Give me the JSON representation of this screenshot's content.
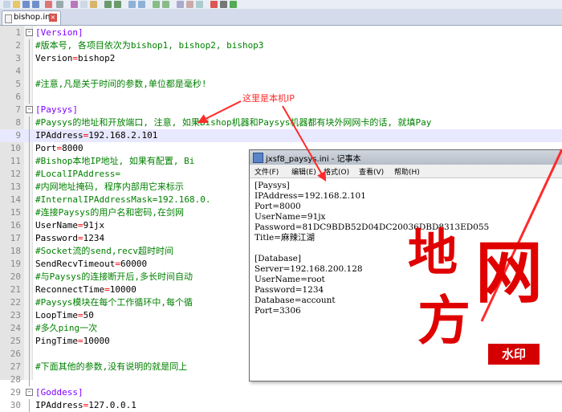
{
  "tab": {
    "label": "bishop.ini"
  },
  "editor": {
    "lines": [
      {
        "n": "1",
        "type": "section",
        "text": "[Version]"
      },
      {
        "n": "2",
        "type": "comment",
        "text": "#版本号, 各项目依次为bishop1, bishop2, bishop3"
      },
      {
        "n": "3",
        "type": "kv",
        "key": "Version",
        "value": "bishop2"
      },
      {
        "n": "4",
        "type": "blank",
        "text": ""
      },
      {
        "n": "5",
        "type": "comment",
        "text": "#注意,凡是关于时间的参数,单位都是毫秒!"
      },
      {
        "n": "6",
        "type": "blank",
        "text": ""
      },
      {
        "n": "7",
        "type": "section",
        "text": "[Paysys]"
      },
      {
        "n": "8",
        "type": "comment",
        "text": "#Paysys的地址和开放端口, 注意, 如果Bishop机器和Paysys机器都有块外网网卡的话, 就填Pay"
      },
      {
        "n": "9",
        "type": "kv",
        "key": "IPAddress",
        "value": "192.168.2.101",
        "highlight": true
      },
      {
        "n": "10",
        "type": "kv",
        "key": "Port",
        "value": "8000"
      },
      {
        "n": "11",
        "type": "comment",
        "text": "#Bishop本地IP地址, 如果有配置, Bi"
      },
      {
        "n": "12",
        "type": "comment",
        "text": "#LocalIPAddress="
      },
      {
        "n": "13",
        "type": "comment",
        "text": "#内网地址掩码, 程序内部用它来标示"
      },
      {
        "n": "14",
        "type": "comment",
        "text": "#InternalIPAddressMask=192.168.0."
      },
      {
        "n": "15",
        "type": "comment",
        "text": "#连接Paysys的用户名和密码,在剑网"
      },
      {
        "n": "16",
        "type": "kv",
        "key": "UserName",
        "value": "91jx"
      },
      {
        "n": "17",
        "type": "kv",
        "key": "Password",
        "value": "1234"
      },
      {
        "n": "18",
        "type": "comment",
        "text": "#Socket流的send,recv超时时间"
      },
      {
        "n": "19",
        "type": "kv",
        "key": "SendRecvTimeout",
        "value": "60000"
      },
      {
        "n": "20",
        "type": "comment",
        "text": "#与Paysys的连接断开后,多长时间自动"
      },
      {
        "n": "21",
        "type": "kv",
        "key": "ReconnectTime",
        "value": "10000"
      },
      {
        "n": "22",
        "type": "comment",
        "text": "#Paysys模块在每个工作循环中,每个循"
      },
      {
        "n": "23",
        "type": "kv",
        "key": "LoopTime",
        "value": "50"
      },
      {
        "n": "24",
        "type": "comment",
        "text": "#多久ping一次"
      },
      {
        "n": "25",
        "type": "kv",
        "key": "PingTime",
        "value": "10000"
      },
      {
        "n": "26",
        "type": "blank",
        "text": ""
      },
      {
        "n": "27",
        "type": "comment",
        "text": "#下面其他的参数,没有说明的就是同上"
      },
      {
        "n": "28",
        "type": "blank",
        "text": ""
      },
      {
        "n": "29",
        "type": "section",
        "text": "[Goddess]"
      },
      {
        "n": "30",
        "type": "kv",
        "key": "IPAddress",
        "value": "127.0.0.1"
      }
    ]
  },
  "notepad": {
    "title": "jxsf8_paysys.ini - 记事本",
    "menu": [
      "文件(F)",
      "编辑(E)",
      "格式(O)",
      "查看(V)",
      "帮助(H)"
    ],
    "lines": [
      "[Paysys]",
      "IPAddress=192.168.2.101",
      "Port=8000",
      "UserName=91jx",
      "Password=81DC9BDB52D04DC20036DBD8313ED055",
      "Title=麻辣江湖",
      "",
      "[Database]",
      "Server=192.168.200.128",
      "UserName=root",
      "Password=1234",
      "Database=account",
      "Port=3306"
    ]
  },
  "annotation": {
    "text": "这里是本机IP",
    "color": "#ff2a2a"
  },
  "watermark": {
    "chars": [
      "地",
      "网",
      "方"
    ],
    "stamp": "水印",
    "color": "#e00000"
  }
}
